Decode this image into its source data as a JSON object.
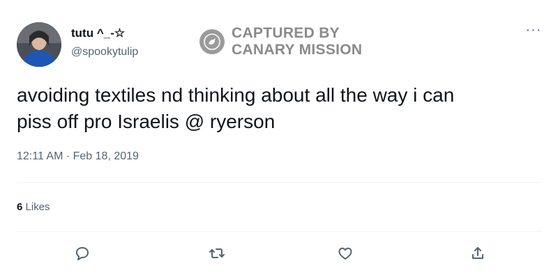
{
  "user": {
    "display_name": "tutu ^_-☆",
    "handle": "@spookytulip",
    "avatar_icon": "profile-photo"
  },
  "watermark": {
    "line1": "CAPTURED BY",
    "line2": "CANARY MISSION",
    "icon": "bird-logo-icon"
  },
  "menu": {
    "more_icon": "more-horizontal-icon",
    "glyph": "···"
  },
  "tweet": {
    "text_line1": "avoiding textiles nd thinking about all the way i can",
    "text_line2": "piss off pro Israelis @ ryerson",
    "timestamp": "12:11 AM · Feb 18, 2019"
  },
  "stats": {
    "likes_count": "6",
    "likes_label": "Likes"
  },
  "actions": [
    "reply-icon",
    "retweet-icon",
    "like-icon",
    "share-icon"
  ],
  "colors": {
    "text": "#0f1419",
    "secondary": "#536471",
    "accent": "#1d9bf0",
    "divider": "#eff3f4"
  }
}
